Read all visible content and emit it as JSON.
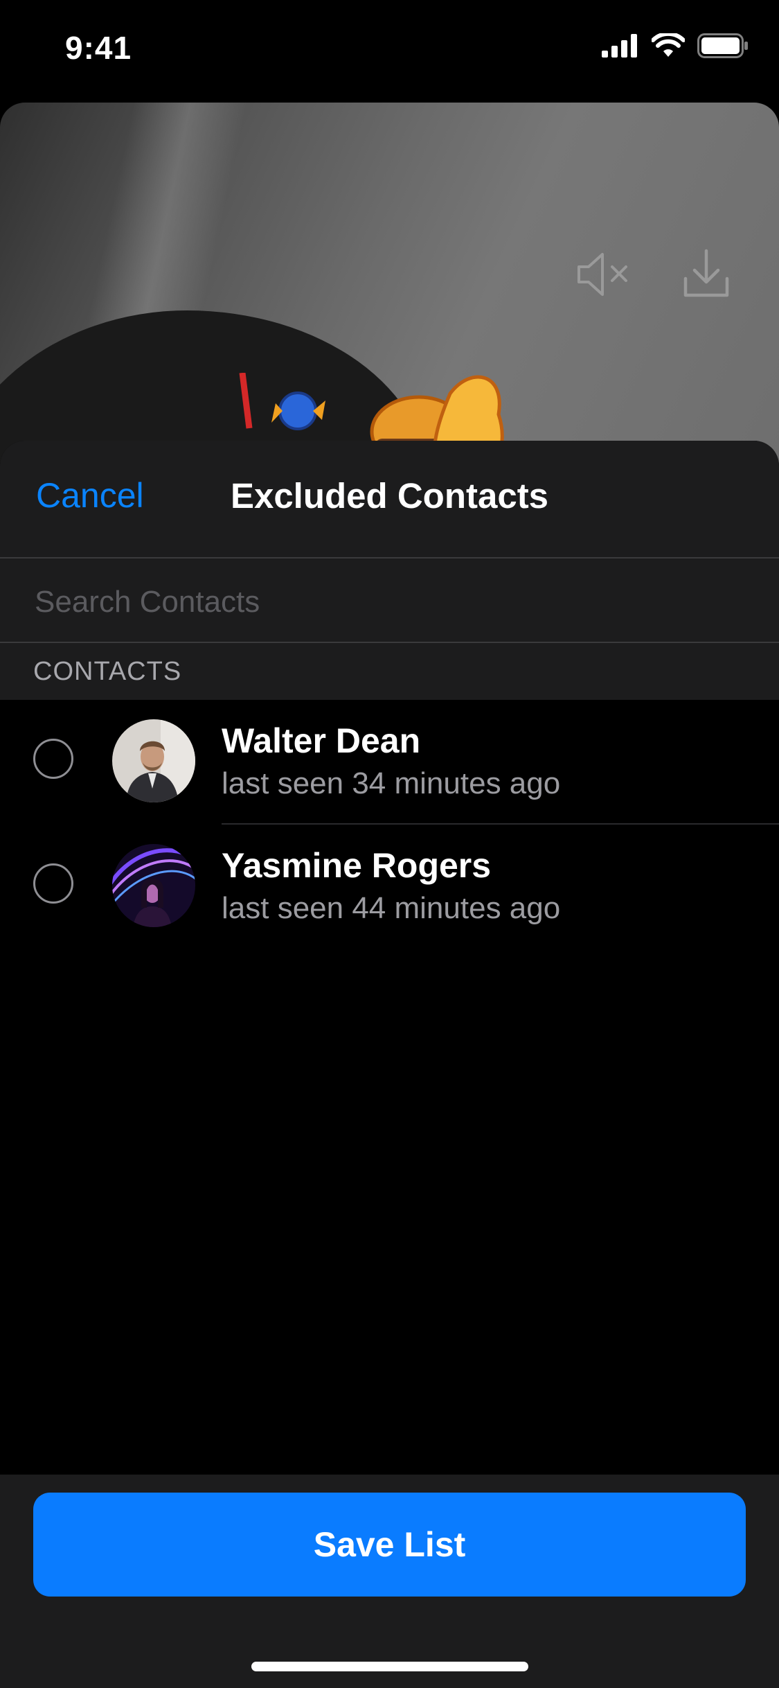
{
  "status_bar": {
    "time": "9:41",
    "signal_icon": "cellular-signal-icon",
    "wifi_icon": "wifi-icon",
    "battery_icon": "battery-icon"
  },
  "story": {
    "mute_icon": "speaker-muted-icon",
    "download_icon": "download-icon",
    "sticker": "food-sticker"
  },
  "nav": {
    "cancel_label": "Cancel",
    "title": "Excluded Contacts"
  },
  "search": {
    "placeholder": "Search Contacts",
    "value": ""
  },
  "section": {
    "title": "CONTACTS"
  },
  "contacts": [
    {
      "name": "Walter Dean",
      "status": "last seen 34 minutes ago",
      "selected": false
    },
    {
      "name": "Yasmine Rogers",
      "status": "last seen 44 minutes ago",
      "selected": false
    }
  ],
  "footer": {
    "save_label": "Save List"
  },
  "colors": {
    "accent": "#0a84ff",
    "button": "#0a7cff",
    "sheet_bg": "#1c1c1d",
    "background": "#000000"
  }
}
